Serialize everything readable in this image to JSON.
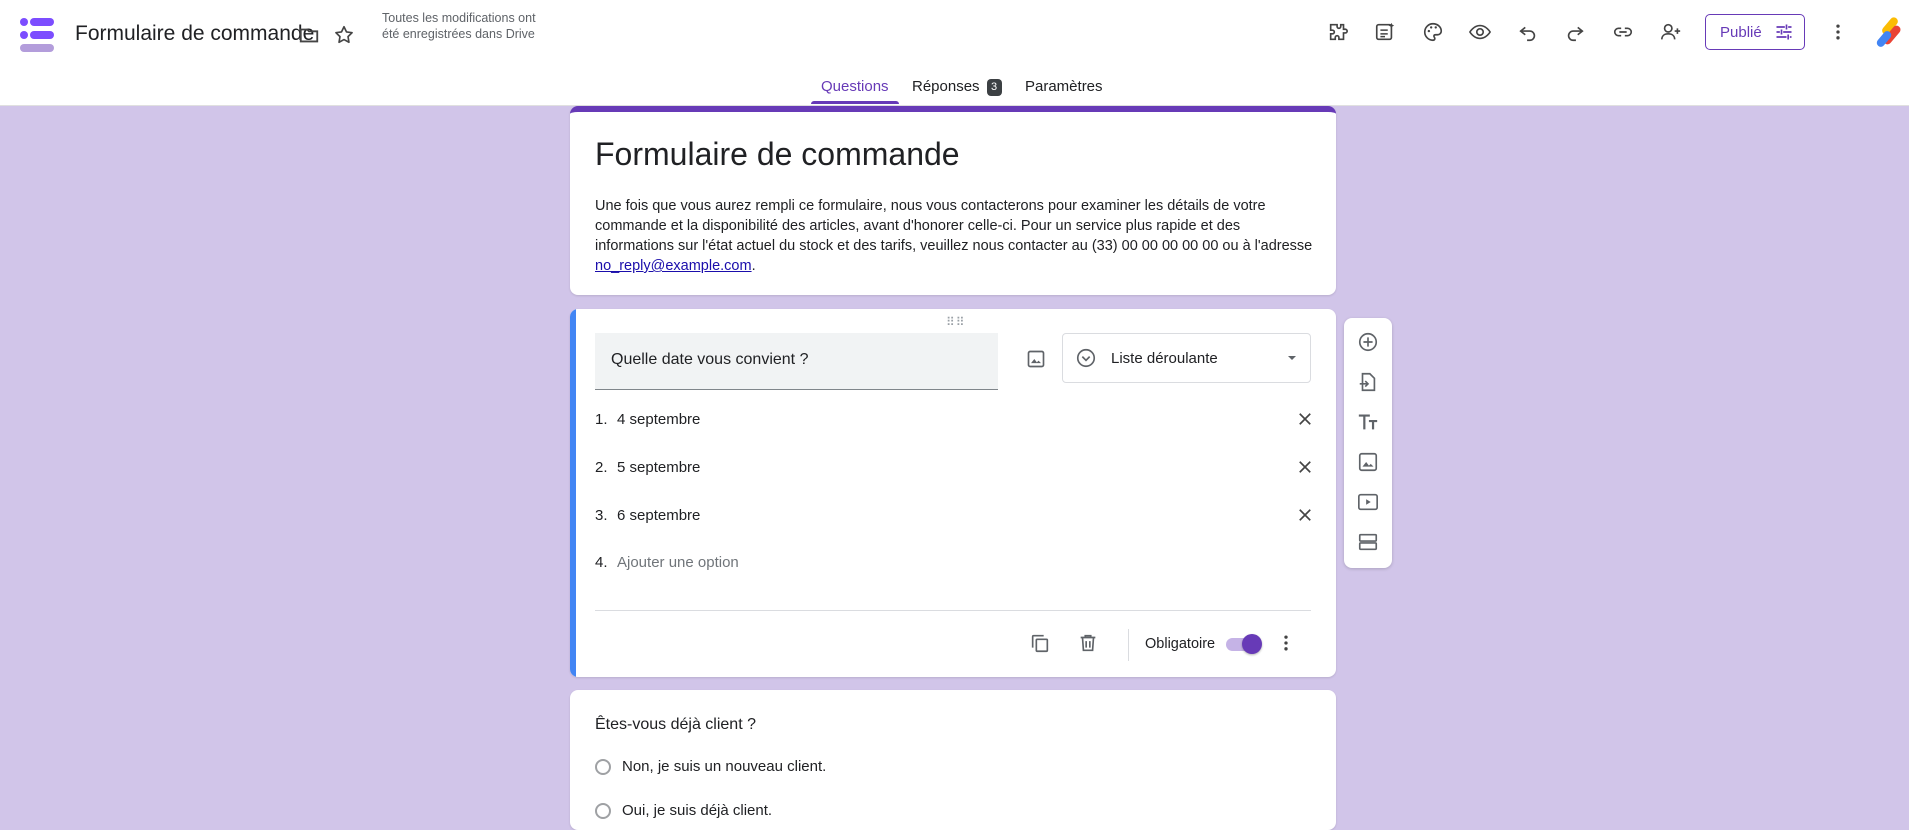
{
  "header": {
    "title": "Formulaire de commande",
    "save_status": "Toutes les modifications ont été enregistrées dans Drive",
    "publish_label": "Publié"
  },
  "tabs": [
    {
      "label": "Questions",
      "active": true
    },
    {
      "label": "Réponses",
      "badge": "3"
    },
    {
      "label": "Paramètres"
    }
  ],
  "form": {
    "title": "Formulaire de commande",
    "description": "Une fois que vous aurez rempli ce formulaire, nous vous contacterons pour examiner les détails de votre commande et la disponibilité des articles, avant d'honorer celle-ci. Pour un service plus rapide et des informations sur l'état actuel du stock et des tarifs, veuillez nous contacter au (33) 00 00 00 00 00 ou à l'adresse ",
    "email": "no_reply@example.com",
    "desc_end": "."
  },
  "question1": {
    "title": "Quelle date vous convient ?",
    "type": "Liste déroulante",
    "options": [
      {
        "num": "1.",
        "text": "4 septembre"
      },
      {
        "num": "2.",
        "text": "5 septembre"
      },
      {
        "num": "3.",
        "text": "6 septembre"
      }
    ],
    "add_num": "4.",
    "add_option": "Ajouter une option",
    "required_label": "Obligatoire",
    "required": true
  },
  "question2": {
    "title": "Êtes-vous déjà client ?",
    "options": [
      "Non, je suis un nouveau client.",
      "Oui, je suis déjà client."
    ]
  },
  "colors": {
    "accent": "#673ab7",
    "background": "#d1c5e9",
    "focus": "#4285f4"
  }
}
